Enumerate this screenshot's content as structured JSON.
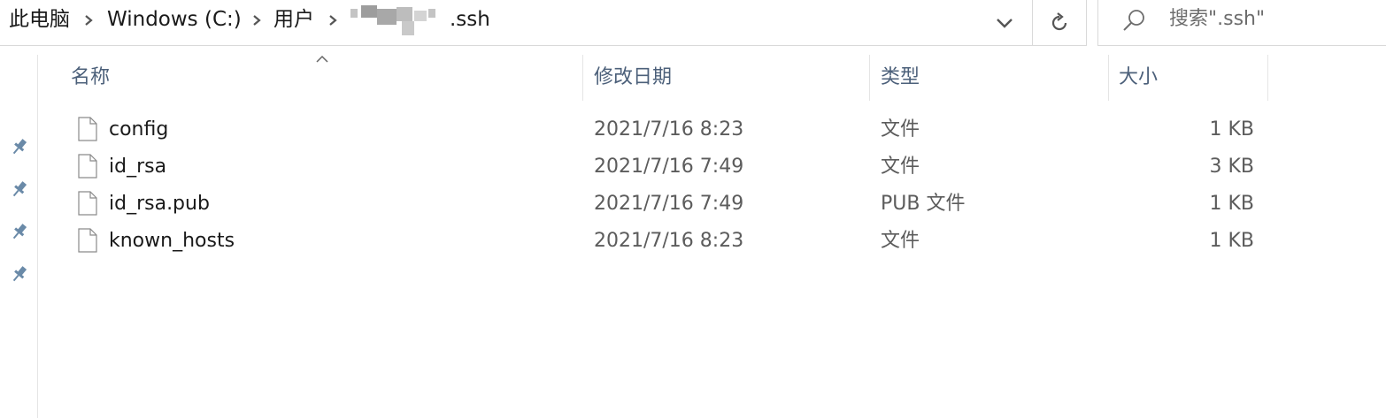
{
  "address_bar": {
    "crumbs": [
      "此电脑",
      "Windows (C:)",
      "用户",
      ".ssh"
    ],
    "search_placeholder": "搜索\".ssh\""
  },
  "columns": {
    "name": "名称",
    "date": "修改日期",
    "type": "类型",
    "size": "大小"
  },
  "files": [
    {
      "name": "config",
      "date": "2021/7/16 8:23",
      "type": "文件",
      "size": "1 KB"
    },
    {
      "name": "id_rsa",
      "date": "2021/7/16 7:49",
      "type": "文件",
      "size": "3 KB"
    },
    {
      "name": "id_rsa.pub",
      "date": "2021/7/16 7:49",
      "type": "PUB 文件",
      "size": "1 KB"
    },
    {
      "name": "known_hosts",
      "date": "2021/7/16 8:23",
      "type": "文件",
      "size": "1 KB"
    }
  ],
  "icons": {
    "crumb_separator": "chevron-right-icon",
    "dropdown": "chevron-down-icon",
    "refresh": "refresh-icon",
    "search": "search-icon",
    "pin": "pin-icon",
    "file": "file-icon"
  }
}
